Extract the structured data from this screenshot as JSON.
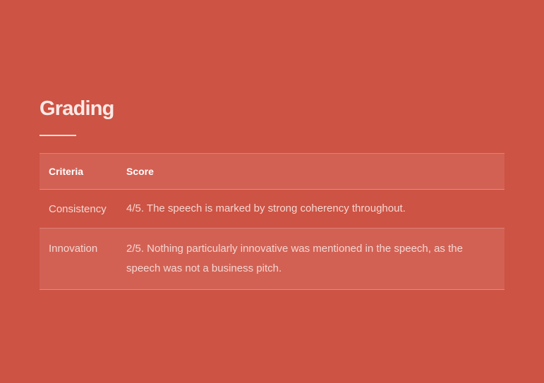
{
  "section": {
    "title": "Grading"
  },
  "table": {
    "headers": {
      "criteria": "Criteria",
      "score": "Score"
    },
    "rows": [
      {
        "criteria": "Consistency",
        "score": "4/5. The speech is marked by strong coherency throughout."
      },
      {
        "criteria": "Innovation",
        "score": "2/5. Nothing particularly innovative was mentioned in the speech, as the speech was not a business pitch."
      }
    ]
  },
  "colors": {
    "background": "#cd5344",
    "stripe": "#d26154",
    "title_text": "#fbe9e6",
    "body_text": "#f5d6d1"
  }
}
